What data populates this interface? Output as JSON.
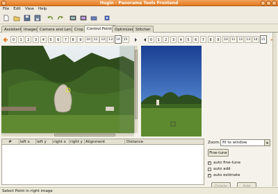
{
  "window": {
    "title": "Hugin - Panorama Tools Frontend"
  },
  "menu": [
    "File",
    "Edit",
    "View",
    "Help"
  ],
  "toolbar_icons": [
    "new-icon",
    "open-icon",
    "save-icon",
    "save-as-icon",
    "undo-icon",
    "redo-icon",
    "preview-icon",
    "fast-preview-icon",
    "align-icon"
  ],
  "tabs": [
    "Assistant",
    "Images",
    "Camera and Lens",
    "Crop",
    "Control Points",
    "Optimizer",
    "Stitcher"
  ],
  "active_tab": "Control Points",
  "left_images": [
    "0",
    "1",
    "2",
    "3",
    "4",
    "5",
    "6",
    "7",
    "8",
    "9",
    "10",
    "11",
    "12",
    "13",
    "14",
    "15"
  ],
  "left_selected": "14",
  "right_images": [
    "0",
    "1",
    "2",
    "3",
    "4",
    "5",
    "6",
    "7",
    "8",
    "9",
    "10",
    "11",
    "12",
    "13",
    "14",
    "15"
  ],
  "right_selected": "15",
  "table_columns": [
    "#",
    "left x",
    "left y",
    "right x",
    "right y",
    "Alignment",
    "Distance"
  ],
  "zoom": {
    "label": "Zoom:",
    "value": "fit to window"
  },
  "buttons": {
    "finetune": "Fine-tune",
    "delete": "Delete",
    "add": "Add"
  },
  "options": [
    {
      "label": "auto fine-tune",
      "checked": true
    },
    {
      "label": "auto add",
      "checked": false
    },
    {
      "label": "auto estimate",
      "checked": true
    }
  ],
  "status": "Select Point in right image"
}
